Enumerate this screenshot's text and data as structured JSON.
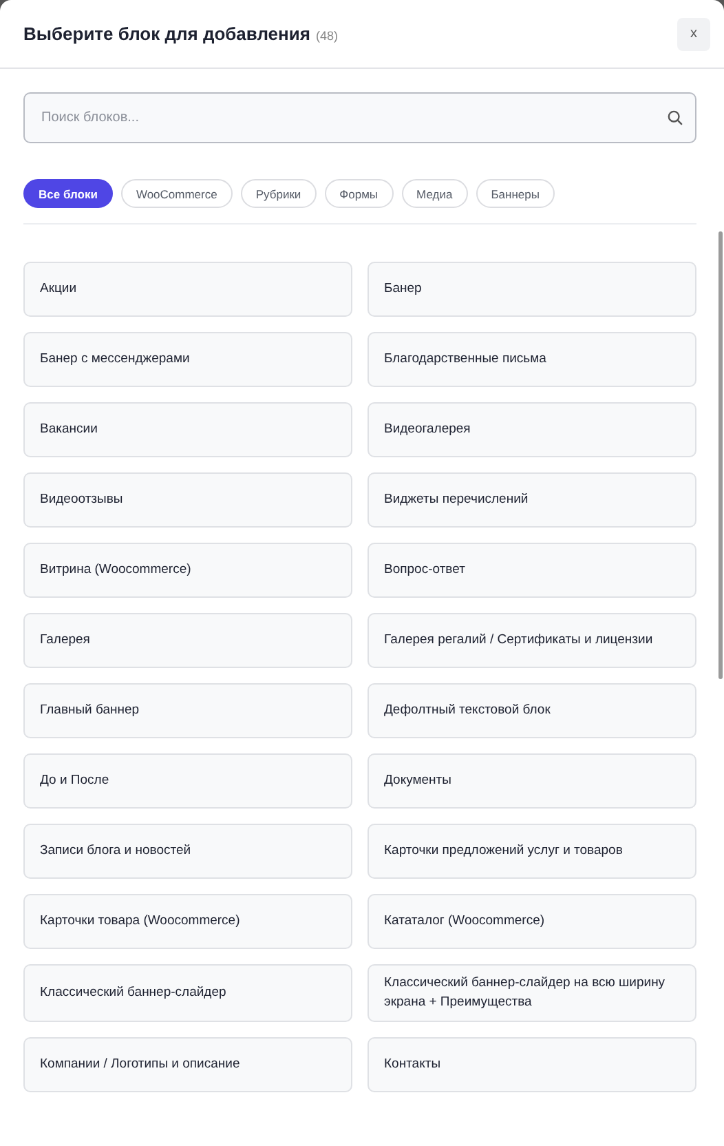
{
  "dialog": {
    "title": "Выберите блок для добавления",
    "count": "(48)",
    "close": "x"
  },
  "search": {
    "placeholder": "Поиск блоков..."
  },
  "filters": [
    {
      "label": "Все блоки",
      "selected": true
    },
    {
      "label": "WooCommerce",
      "selected": false
    },
    {
      "label": "Рубрики",
      "selected": false
    },
    {
      "label": "Формы",
      "selected": false
    },
    {
      "label": "Медиа",
      "selected": false
    },
    {
      "label": "Баннеры",
      "selected": false
    }
  ],
  "blocks": [
    "Акции",
    "Банер",
    "Банер с мессенджерами",
    "Благодарственные письма",
    "Вакансии",
    "Видеогалерея",
    "Видеоотзывы",
    "Виджеты перечислений",
    "Витрина (Woocommerce)",
    "Вопрос-ответ",
    "Галерея",
    "Галерея регалий / Сертификаты и лицензии",
    "Главный баннер",
    "Дефолтный текстовой блок",
    "До и После",
    "Документы",
    "Записи блога и новостей",
    "Карточки предложений услуг и товаров",
    "Карточки товара (Woocommerce)",
    "Кататалог (Woocommerce)",
    "Классический баннер-слайдер",
    "Классический баннер-слайдер на всю ширину экрана + Преимущества",
    "Компании / Логотипы и описание",
    "Контакты"
  ]
}
